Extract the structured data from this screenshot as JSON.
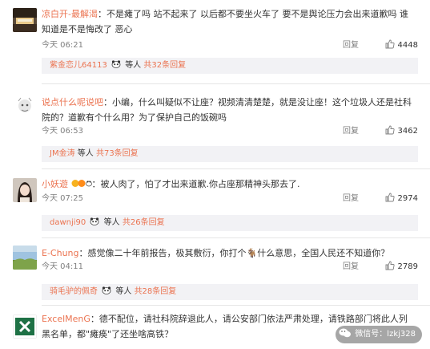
{
  "comments": [
    {
      "username": "凉白开-最解渴",
      "text": "：不是瘫了吗 站不起来了 以后都不要坐火车了 要不是舆论压力会出来道歉吗 谁知道是不是悔改了 恶心",
      "time": "今天 06:21",
      "reply_label": "回复",
      "likes": "4448",
      "reply_preview": {
        "name": "紫金恋儿64113",
        "suffix": "等人",
        "total": "共32条回复"
      }
    },
    {
      "username": "说点什么呢说吧",
      "text": "：小编，什么叫疑似不让座？视频清清楚楚，就是没让座！这个垃圾人还是社科院的？道歉有个什么用？为了保护自己的饭碗吗",
      "time": "今天 06:53",
      "reply_label": "回复",
      "likes": "3462",
      "reply_preview": {
        "name": "JM金涛",
        "suffix": "等人",
        "total": "共73条回复"
      }
    },
    {
      "username": "小妖遊",
      "text": "：被人肉了，怕了才出来道歉.你占座那精神头那去了.",
      "time": "今天 07:25",
      "reply_label": "回复",
      "likes": "2974",
      "reply_preview": {
        "name": "dawnji90",
        "suffix": "等人",
        "total": "共26条回复"
      }
    },
    {
      "username": "E-Chung",
      "text": "：感觉像二十年前报告，极其敷衍，你打个🐐什么意思，全国人民还不知道你？",
      "time": "今天 04:11",
      "reply_label": "回复",
      "likes": "2789",
      "reply_preview": {
        "name": "骑毛驴的佩奇",
        "suffix": "等人",
        "total": "共28条回复"
      }
    },
    {
      "username": "ExcelMenG",
      "text": "：德不配位，请社科院辞退此人，请公安部门依法严肃处理，请铁路部门将此人列黑名单，都\"瘫痪\"了还坐啥高铁？"
    }
  ],
  "watermark": {
    "text": "微信号：lzkj328"
  },
  "colors": {
    "username": "#eb7350",
    "link": "#507daf",
    "meta": "#808080",
    "reply_bg": "#f2f2f5"
  }
}
